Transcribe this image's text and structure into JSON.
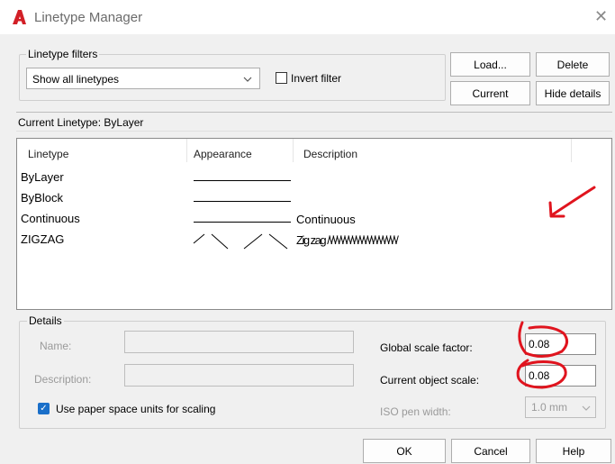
{
  "window": {
    "title": "Linetype Manager",
    "close_glyph": "✕"
  },
  "filters": {
    "group_label": "Linetype filters",
    "selected": "Show all linetypes",
    "invert_label": "Invert filter"
  },
  "buttons": {
    "load": "Load...",
    "delete": "Delete",
    "current": "Current",
    "hide_details": "Hide details",
    "ok": "OK",
    "cancel": "Cancel",
    "help": "Help"
  },
  "current_linetype": "Current Linetype:  ByLayer",
  "table": {
    "headers": [
      "Linetype",
      "Appearance",
      "Description"
    ],
    "rows": [
      {
        "name": "ByLayer",
        "appearance": "solid",
        "description": ""
      },
      {
        "name": "ByBlock",
        "appearance": "solid",
        "description": ""
      },
      {
        "name": "Continuous",
        "appearance": "solid",
        "description": "Continuous"
      },
      {
        "name": "ZIGZAG",
        "appearance": "zigzag",
        "description": "Zig zag /\\/\\/\\/\\/\\/\\/\\/\\/\\/\\/\\/\\/\\/\\/\\/\\/\\/\\/"
      }
    ]
  },
  "details": {
    "group_label": "Details",
    "name_label": "Name:",
    "description_label": "Description:",
    "paper_space_label": "Use paper space units for scaling",
    "global_scale_label": "Global scale factor:",
    "global_scale_value": "0.08",
    "object_scale_label": "Current object scale:",
    "object_scale_value": "0.08",
    "iso_pen_label": "ISO pen width:",
    "iso_pen_value": "1.0 mm"
  },
  "colors": {
    "annotation": "#e0141e",
    "accent": "#1a6fc9",
    "app_icon": "#d21f26"
  }
}
